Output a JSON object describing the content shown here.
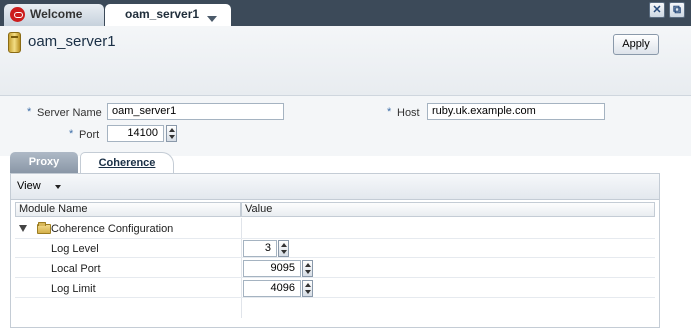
{
  "tabs": {
    "welcome_label": "Welcome",
    "server_label": "oam_server1"
  },
  "window_buttons": {
    "close_icon": "close-icon",
    "detach_icon": "detach-window-icon"
  },
  "header": {
    "title": "oam_server1",
    "apply_label": "Apply",
    "icon": "server-icon"
  },
  "form": {
    "server_name_label": "Server Name",
    "server_name_value": "oam_server1",
    "host_label": "Host",
    "host_value": "ruby.uk.example.com",
    "port_label": "Port",
    "port_value": "14100",
    "required_marker": "*"
  },
  "subtabs": {
    "proxy_label": "Proxy",
    "coherence_label": "Coherence"
  },
  "toolbar": {
    "view_label": "View"
  },
  "table": {
    "columns": [
      "Module Name",
      "Value"
    ],
    "group_label": "Coherence Configuration",
    "rows": [
      {
        "name": "Log Level",
        "value": "3"
      },
      {
        "name": "Local Port",
        "value": "9095"
      },
      {
        "name": "Log Limit",
        "value": "4096"
      }
    ]
  },
  "colors": {
    "tabstrip": "#3c4a59",
    "accent": "#3f6fa8",
    "oracle_red": "#cc1d1d"
  }
}
